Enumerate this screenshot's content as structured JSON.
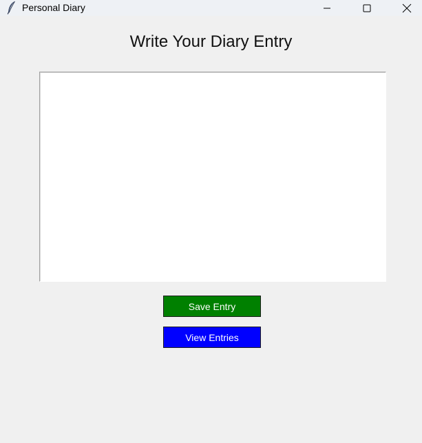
{
  "window": {
    "title": "Personal Diary",
    "icon": "feather-icon",
    "controls": [
      "minimize-icon",
      "maximize-icon",
      "close-icon"
    ]
  },
  "main": {
    "heading": "Write Your Diary Entry",
    "entry_text": "",
    "save_label": "Save Entry",
    "view_label": "View Entries"
  },
  "colors": {
    "save_button": "#008000",
    "view_button": "#0000ff",
    "button_text": "#ffffff",
    "background": "#f0f0f0"
  }
}
